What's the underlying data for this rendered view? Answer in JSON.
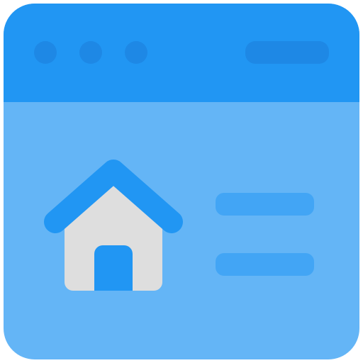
{
  "icon": {
    "name": "homepage-browser-icon",
    "colors": {
      "header_blue": "#2196F3",
      "header_dot_blue": "#1E88E5",
      "body_blue": "#64B5F6",
      "line_blue": "#42A5F5",
      "roof_blue": "#2196F3",
      "house_gray": "#DEDEDE",
      "door_blue": "#2196F3"
    }
  }
}
